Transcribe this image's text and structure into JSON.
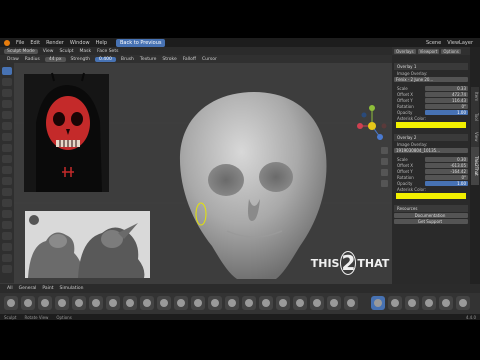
{
  "menubar": {
    "items": [
      "File",
      "Edit",
      "Render",
      "Window",
      "Help"
    ],
    "back_button": "Back to Previous",
    "scene": "Scene",
    "view_layer": "ViewLayer"
  },
  "header2": {
    "mode": "Sculpt Mode",
    "menus": [
      "View",
      "Sculpt",
      "Mask",
      "Face Sets"
    ]
  },
  "header3": {
    "tool": "Draw",
    "radius_label": "Radius",
    "radius_value": "44 px",
    "strength_label": "Strength",
    "strength_value": "0.400",
    "menus": [
      "Brush",
      "Texture",
      "Stroke",
      "Falloff",
      "Cursor"
    ]
  },
  "sidebar": {
    "tabs": [
      "Item",
      "Tool",
      "View",
      "This2That"
    ],
    "header_buttons": [
      "Overlays",
      "Viewport",
      "Options"
    ],
    "overlay1": {
      "title": "Overlay 1",
      "image_overlay_label": "Image Overlay:",
      "image_name": "Fenix - 2 June 20...",
      "rows": [
        {
          "label": "Scale",
          "value": "0.33"
        },
        {
          "label": "Offset X",
          "value": "472.74"
        },
        {
          "label": "Offset Y",
          "value": "116.43"
        },
        {
          "label": "Rotation",
          "value": "0°"
        },
        {
          "label": "Opacity",
          "value": "1.00"
        }
      ],
      "color_label": "Asterisk Color:",
      "color": "#f2f000"
    },
    "overlay2": {
      "title": "Overlay 2",
      "image_overlay_label": "Image Overlay:",
      "image_name": "1919030804_10135...",
      "rows": [
        {
          "label": "Scale",
          "value": "0.30"
        },
        {
          "label": "Offset X",
          "value": "-613.05"
        },
        {
          "label": "Offset Y",
          "value": "-164.42"
        },
        {
          "label": "Rotation",
          "value": "0°"
        },
        {
          "label": "Opacity",
          "value": "1.00"
        }
      ],
      "color_label": "Asterisk Color:",
      "color": "#f2f000"
    },
    "resources": {
      "title": "Resources",
      "buttons": [
        "Documentation",
        "Get Support"
      ]
    }
  },
  "asset_bar": {
    "items": [
      "All",
      "General",
      "Paint",
      "Simulation"
    ]
  },
  "statusbar": {
    "items": [
      "Sculpt",
      "Rotate View",
      "Options"
    ],
    "version": "4.4.0"
  },
  "watermark": {
    "text_before": "THIS",
    "numeral": "2",
    "text_after": "THAT"
  },
  "colors": {
    "accent": "#4772b3",
    "skull_paint": "#c42a2a",
    "asterisk_yellow": "#f2f000"
  }
}
